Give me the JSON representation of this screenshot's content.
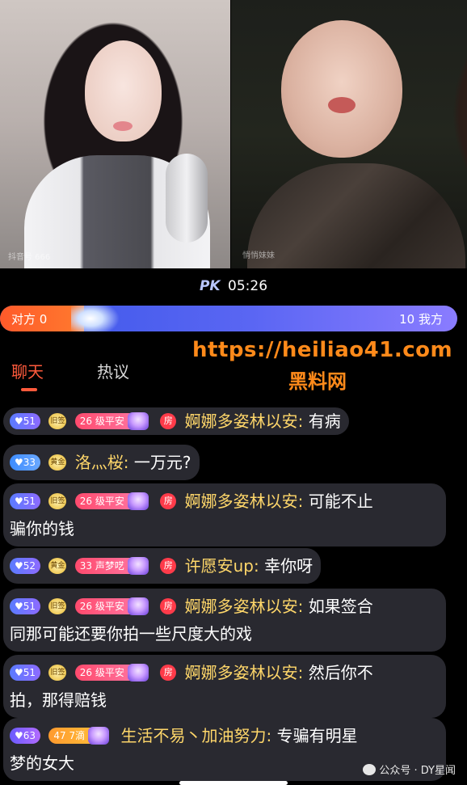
{
  "videos": {
    "left_tag": "抖音号 666",
    "right_tag": "悄悄妹妹"
  },
  "pk": {
    "logo": "PK",
    "timer": "05:26",
    "left_label": "对方 0",
    "right_label": "10 我方"
  },
  "tabs": [
    {
      "label": "聊天"
    },
    {
      "label": "热议"
    }
  ],
  "watermark": {
    "url": "https://heiliao41.com",
    "cn": "黑料网"
  },
  "chat": [
    {
      "level": "51",
      "gold": "旧签",
      "fan_level": "26",
      "fan_name": "级平安",
      "room": "房",
      "name": "婀娜多姿林以安:",
      "text": "有病"
    },
    {
      "level": "33",
      "gold": "黄金",
      "name": "洛灬桜:",
      "text": "一万元?"
    },
    {
      "level": "51",
      "gold": "旧签",
      "fan_level": "26",
      "fan_name": "级平安",
      "room": "房",
      "name": "婀娜多姿林以安:",
      "text": "可能不止",
      "text2": "骗你的钱"
    },
    {
      "level": "52",
      "gold": "黄金",
      "fan_level": "33",
      "fan_name": "声梦呓",
      "room": "房",
      "name": "许愿安up:",
      "text": "幸你呀"
    },
    {
      "level": "51",
      "gold": "旧签",
      "fan_level": "26",
      "fan_name": "级平安",
      "room": "房",
      "name": "婀娜多姿林以安:",
      "text": "如果签合",
      "text2": "同那可能还要你拍一些尺度大的戏"
    },
    {
      "level": "51",
      "gold": "旧签",
      "fan_level": "26",
      "fan_name": "级平安",
      "room": "房",
      "name": "婀娜多姿林以安:",
      "text": "然后你不",
      "text2": "拍，那得赔钱"
    },
    {
      "level": "63",
      "fan_level": "47",
      "fan_name": "7滴",
      "name": "生活不易丶加油努力:",
      "text": "专骗有明星",
      "text2": "梦的女大"
    }
  ],
  "footer": {
    "label": "公众号 · DY星闻"
  }
}
